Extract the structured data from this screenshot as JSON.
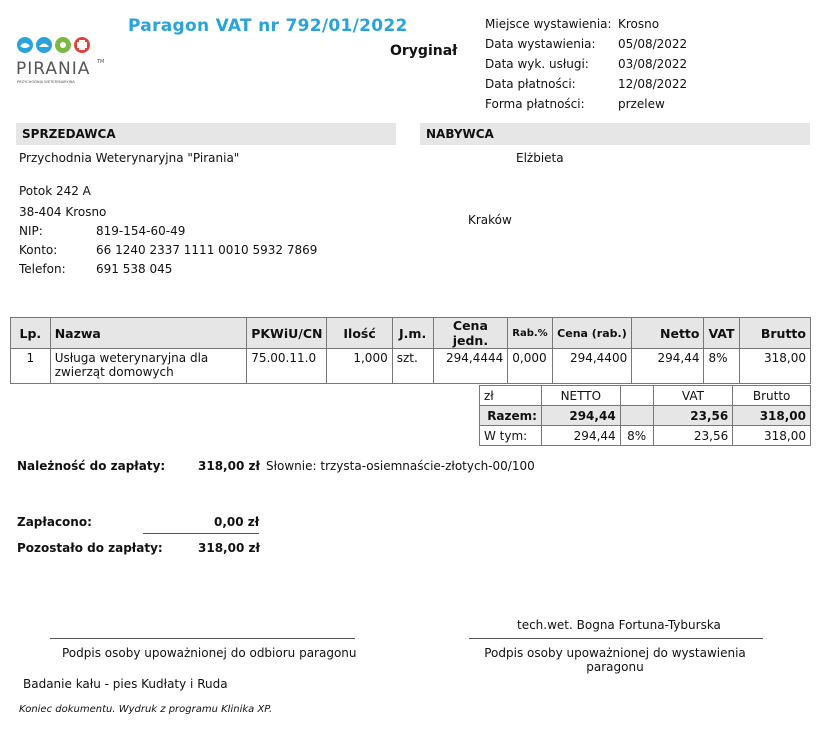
{
  "header": {
    "title": "Paragon VAT nr  792/01/2022",
    "copy_label": "Oryginał",
    "logo_text": "PIRANIA",
    "logo_tagline": "PRZYCHODNIA WETERYNARYJNA",
    "logo_tm": "TM",
    "colors": {
      "title": "#2aa3dc",
      "logo_text": "#555555",
      "badge_blue": "#2aa3dc",
      "badge_green": "#79b944",
      "badge_red": "#e2403a"
    }
  },
  "meta": [
    {
      "label": "Miejsce wystawienia:",
      "value": "Krosno"
    },
    {
      "label": "Data wystawienia:",
      "value": "05/08/2022"
    },
    {
      "label": "Data wyk. usługi:",
      "value": "03/08/2022"
    },
    {
      "label": "Data płatności:",
      "value": "12/08/2022"
    },
    {
      "label": "Forma płatności:",
      "value": "przelew"
    }
  ],
  "seller": {
    "heading": "SPRZEDAWCA",
    "name": "Przychodnia Weterynaryjna \"Pirania\"",
    "street": "Potok 242 A",
    "city": "38-404 Krosno",
    "nip_label": "NIP:",
    "nip": "819-154-60-49",
    "account_label": "Konto:",
    "account": "66 1240 2337 1111 0010 5932 7869",
    "phone_label": "Telefon:",
    "phone": "691 538 045"
  },
  "buyer": {
    "heading": "NABYWCA",
    "name": "Elżbieta",
    "city": "Kraków"
  },
  "items_table": {
    "headers": [
      "Lp.",
      "Nazwa",
      "PKWiU/CN",
      "Ilość",
      "J.m.",
      "Cena jedn.",
      "Rab.%",
      "Cena (rab.)",
      "Netto",
      "VAT",
      "Brutto"
    ],
    "rows": [
      [
        "1",
        "Usługa weterynaryjna dla zwierząt domowych",
        "75.00.11.0",
        "1,000",
        "szt.",
        "294,4444",
        "0,000",
        "294,4400",
        "294,44",
        "8%",
        "318,00"
      ]
    ]
  },
  "summary": {
    "headers": [
      "zł",
      "NETTO",
      "",
      "VAT",
      "Brutto"
    ],
    "total_row": [
      "Razem:",
      "294,44",
      "",
      "23,56",
      "318,00"
    ],
    "incl_row": [
      "W tym:",
      "294,44",
      "8%",
      "23,56",
      "318,00"
    ]
  },
  "payment": {
    "due_label": "Należność do zapłaty:",
    "due_value": "318,00 zł",
    "words": "Słownie: trzysta-osiemnaście-złotych-00/100",
    "paid_label": "Zapłacono:",
    "paid_value": "0,00 zł",
    "remaining_label": "Pozostało do zapłaty:",
    "remaining_value": "318,00 zł"
  },
  "signatures": {
    "issuer_name": "tech.wet. Bogna Fortuna-Tyburska",
    "receiver_caption": "Podpis osoby upoważnionej do odbioru paragonu",
    "issuer_caption": "Podpis osoby upoważnionej do wystawienia paragonu"
  },
  "note": "Badanie kału - pies Kudłaty i Ruda",
  "footer": "Koniec dokumentu. Wydruk z programu Klinika XP."
}
